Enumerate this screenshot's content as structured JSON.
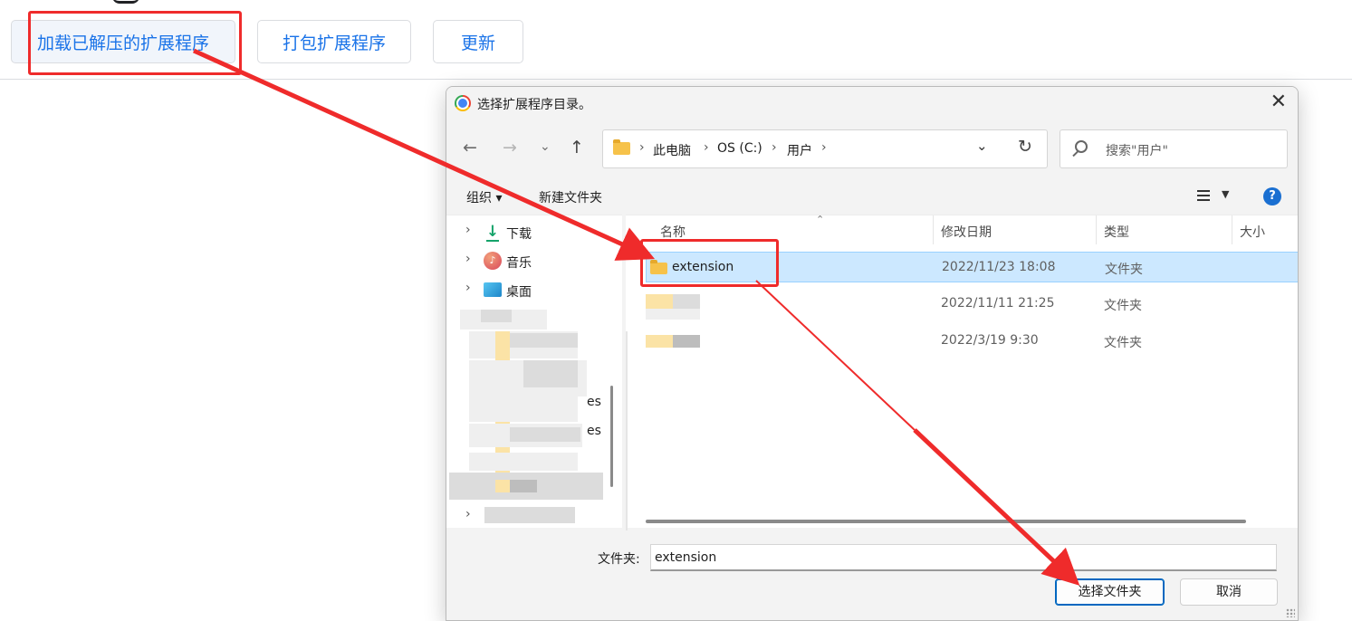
{
  "extensions_toolbar": {
    "load_unpacked": "加载已解压的扩展程序",
    "pack_extension": "打包扩展程序",
    "update": "更新"
  },
  "dialog": {
    "title": "选择扩展程序目录。",
    "close_glyph": "✕",
    "address": {
      "crumbs": [
        "此电脑",
        "OS (C:)",
        "用户"
      ],
      "separator": "›"
    },
    "search": {
      "placeholder": "搜索\"用户\""
    },
    "commands": {
      "organize": "组织 ▾",
      "new_folder": "新建文件夹",
      "help": "?"
    },
    "nav_pane": {
      "items": [
        {
          "label": "下载",
          "icon": "download-icon"
        },
        {
          "label": "音乐",
          "icon": "music-icon"
        },
        {
          "label": "桌面",
          "icon": "desktop-icon"
        }
      ],
      "obscured_tail_1": "es",
      "obscured_tail_2": "es"
    },
    "columns": {
      "name": "名称",
      "modified": "修改日期",
      "type": "类型",
      "size": "大小"
    },
    "files": [
      {
        "name": "extension",
        "modified": "2022/11/23 18:08",
        "type": "文件夹",
        "selected": true
      },
      {
        "name": "",
        "modified": "2022/11/11 21:25",
        "type": "文件夹",
        "selected": false
      },
      {
        "name": "",
        "modified": "2022/3/19 9:30",
        "type": "文件夹",
        "selected": false
      }
    ],
    "folder_label": "文件夹:",
    "folder_value": "extension",
    "ok_label": "选择文件夹",
    "cancel_label": "取消"
  },
  "colors": {
    "accent": "#1a73e8",
    "selection": "#cce8ff",
    "annotation": "#ef2b2b",
    "folder": "#f6c24a"
  }
}
